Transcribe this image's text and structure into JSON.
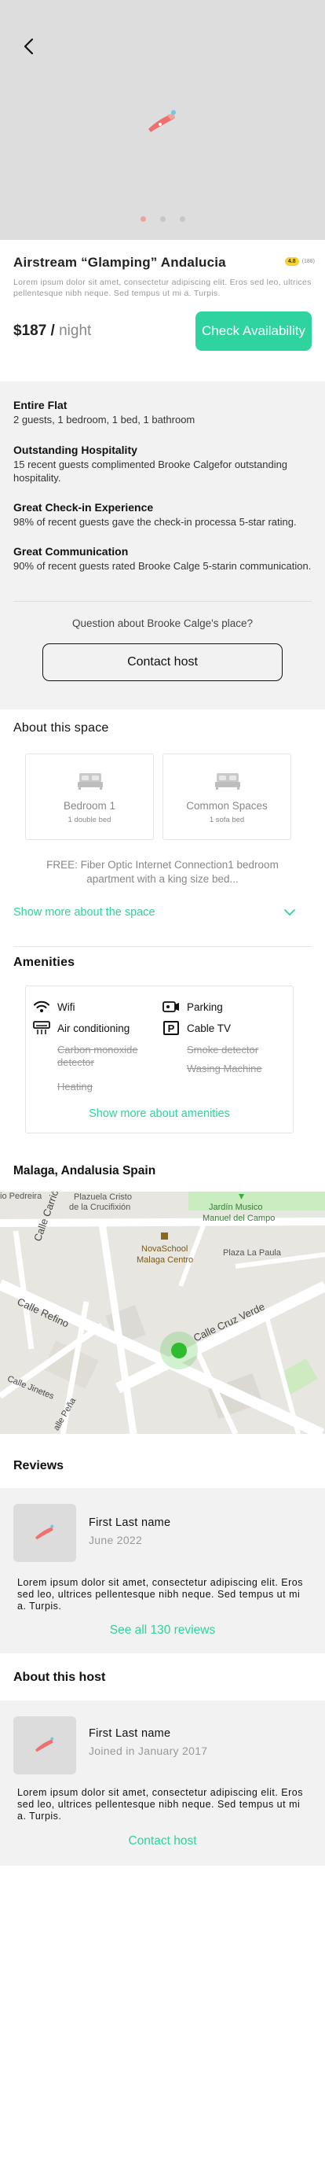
{
  "listing": {
    "title": "Airstream “Glamping” Andalucia",
    "rating": "4.8",
    "rating_count": "(188)",
    "description": "Lorem ipsum dolor sit amet, consectetur adipiscing elit. Eros sed leo, ultrices pellentesque nibh neque. Sed tempus ut mi a. Turpis.",
    "price_amount": "$187 /",
    "price_unit": "night",
    "cta_label": "Check Availability"
  },
  "gallery": {
    "image_count": 3,
    "active_index": 0
  },
  "highlights": [
    {
      "title": "Entire Flat",
      "text": "2 guests, 1 bedroom,  1 bed, 1 bathroom"
    },
    {
      "title": "Outstanding Hospitality",
      "text": "15 recent guests complimented Brooke Calgefor outstanding hospitality."
    },
    {
      "title": "Great Check-in Experience",
      "text": "98% of recent guests gave the check-in processa 5-star rating."
    },
    {
      "title": "Great Communication",
      "text": "90% of recent guests rated Brooke Calge 5-starin communication."
    }
  ],
  "host_question": "Question about Brooke Calge's place?",
  "contact_label": "Contact host",
  "space": {
    "heading": "About this space",
    "rooms": [
      {
        "name": "Bedroom 1",
        "beds": "1 double bed"
      },
      {
        "name": "Common Spaces",
        "beds": "1 sofa bed"
      }
    ],
    "summary": "FREE: Fiber Optic Internet Connection1 bedroom apartment with a king size bed...",
    "show_more": "Show more about the space"
  },
  "amenities": {
    "heading": "Amenities",
    "available": [
      "Wifi",
      "Parking",
      "Air conditioning",
      "Cable TV"
    ],
    "unavailable": [
      "Carbon monoxide detector",
      "Smoke detector",
      "Heating",
      "Wasing Machine"
    ],
    "show_more": "Show more about amenities"
  },
  "location": {
    "heading": "Malaga, Andalusia Spain",
    "map_labels": {
      "l1": "io Pedreira",
      "l2": "Plazuela Cristo",
      "l3": "de la Crucifixión",
      "l4": "Jardín Musico",
      "l5": "Manuel del Campo",
      "l6": "NovaSchool",
      "l7": "Malaga Centro",
      "l8": "Plaza La Paula",
      "r1": "Calle Carrión",
      "r2": "Calle Refino",
      "r3": "Calle Cruz Verde",
      "r4": "Calle Jinetes",
      "r5": "alle Peña"
    }
  },
  "reviews": {
    "heading": "Reviews",
    "reviewer": "First Last name",
    "date": "June 2022",
    "text": "Lorem ipsum dolor sit amet, consectetur adipiscing elit. Eros sed leo, ultrices pellentesque nibh neque. Sed tempus ut mi a. Turpis.",
    "see_all": "See all 130 reviews"
  },
  "host": {
    "heading": "About this host",
    "name": "First Last name",
    "joined": "Joined in January 2017",
    "text": "Lorem ipsum dolor sit amet, consectetur adipiscing elit. Eros sed leo, ultrices pellentesque nibh neque. Sed tempus ut mi a. Turpis.",
    "contact": "Contact host"
  },
  "colors": {
    "accent": "#2ed3a0",
    "rating": "#f7d12e",
    "placeholder": "#dddddd",
    "map_pin": "#2ebd2e"
  },
  "icons": [
    "back-arrow-icon",
    "image-placeholder-icon",
    "bed-icon",
    "chevron-down-icon",
    "wifi-icon",
    "parking-icon",
    "air-conditioning-icon",
    "cable-tv-icon",
    "map-pin-icon"
  ]
}
